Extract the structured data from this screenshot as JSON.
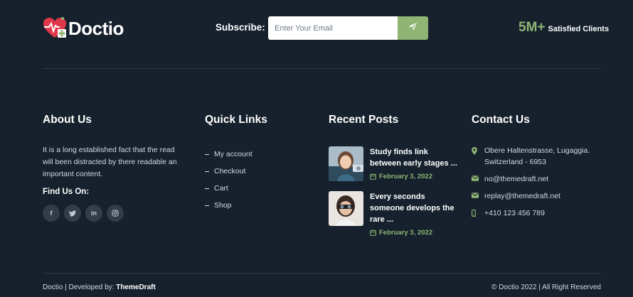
{
  "brand": {
    "name": "Doctio",
    "logo_icon": "heart-pulse-icon"
  },
  "subscribe": {
    "label": "Subscribe:",
    "placeholder": "Enter Your Email",
    "button_icon": "paper-plane-icon"
  },
  "stat": {
    "number": "5M+",
    "label": "Satisfied Clients"
  },
  "about": {
    "title": "About Us",
    "text": "It is a long established fact that the read will been distracted by there readable an important content.",
    "find_us": "Find Us On:",
    "socials": [
      {
        "icon": "facebook-icon",
        "glyph": "f"
      },
      {
        "icon": "twitter-icon",
        "glyph": "t"
      },
      {
        "icon": "linkedin-icon",
        "glyph": "in"
      },
      {
        "icon": "instagram-icon",
        "glyph": "◎"
      }
    ]
  },
  "quick_links": {
    "title": "Quick Links",
    "items": [
      "My account",
      "Checkout",
      "Cart",
      "Shop"
    ]
  },
  "recent_posts": {
    "title": "Recent Posts",
    "items": [
      {
        "title": "Study finds link between early stages ...",
        "date": "February 3, 2022"
      },
      {
        "title": "Every seconds someone develops the rare ...",
        "date": "February 3, 2022"
      }
    ]
  },
  "contact": {
    "title": "Contact Us",
    "address": "Obere Haltenstrasse, Lugaggia. Switzerland - 6953",
    "email1": "no@themedraft.net",
    "email2": "replay@themedraft.net",
    "phone": "+410 123 456 789"
  },
  "footer": {
    "left_prefix": "Doctio | Developed by:",
    "left_brand": "ThemeDraft",
    "right": "© Doctio 2022 | All Right Reserved"
  },
  "colors": {
    "background": "#16212d",
    "accent": "#8fb574",
    "divider": "#2b3744"
  }
}
